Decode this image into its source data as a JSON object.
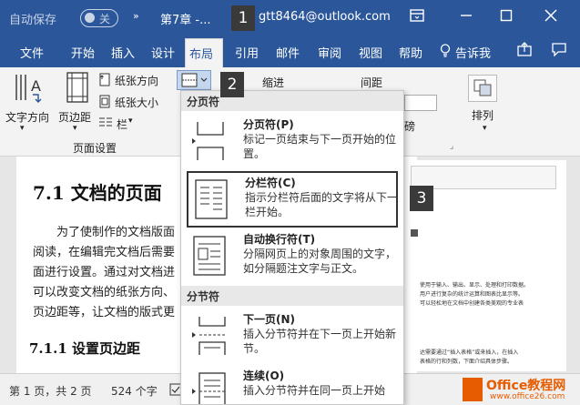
{
  "titlebar": {
    "autosave_label": "自动保存",
    "toggle_label": "关",
    "qa_arrow": "»",
    "doc_title": "第7章 -...",
    "account": "gtt8464@outlook.com"
  },
  "tabs": [
    "文件",
    "开始",
    "插入",
    "设计",
    "布局",
    "引用",
    "邮件",
    "审阅",
    "视图",
    "帮助"
  ],
  "tell_me": "告诉我",
  "ribbon": {
    "text_direction": "文字方向",
    "margins": "页边距",
    "orientation": "纸张方向",
    "size": "纸张大小",
    "columns": "栏",
    "group_page_setup": "页面设置",
    "indent": "缩进",
    "spacing": "间距",
    "arrange": "排列",
    "partial_text": "磅"
  },
  "dropdown": {
    "section_page_breaks": "分页符",
    "section_section_breaks": "分节符",
    "items": [
      {
        "title": "分页符(P)",
        "desc": "标记一页结束与下一页开始的位置。"
      },
      {
        "title": "分栏符(C)",
        "desc": "指示分栏符后面的文字将从下一栏开始。"
      },
      {
        "title": "自动换行符(T)",
        "desc": "分隔网页上的对象周围的文字，如分隔题注文字与正文。"
      },
      {
        "title": "下一页(N)",
        "desc": "插入分节符并在下一页上开始新节。"
      },
      {
        "title": "连续(O)",
        "desc": "插入分节符并在同一页上开始"
      }
    ]
  },
  "document": {
    "heading": "7.1 文档的页面",
    "para_lines": [
      "为了使制作的文档版面",
      "阅读，在编辑完文档后需要",
      "面进行设置。通过对文档进",
      "可以改变文档的纸张方向、",
      "页边距等，让文档的版式更"
    ],
    "subheading": "7.1.1 设置页边距",
    "thumb_lines": [
      "使用于输入、输出、显示、处理和打印数据。",
      "用户进行复杂的统计运算和图表比显示等。",
      "可以轻松地在文档中创建各类美观的专业表",
      "达需要通过“插入表格”或来插入，在插入",
      "表格的行和列数，下面介绍具体步骤。"
    ]
  },
  "status": {
    "page": "第 1 页，共 2 页",
    "words": "524 个字"
  },
  "callouts": [
    "1",
    "2",
    "3"
  ],
  "watermark": {
    "main": "Office教程网",
    "sub": "www.office26.com"
  },
  "colors": {
    "brand": "#2b579a",
    "callout": "#3a3a3a",
    "watermark": "#e65c00"
  }
}
